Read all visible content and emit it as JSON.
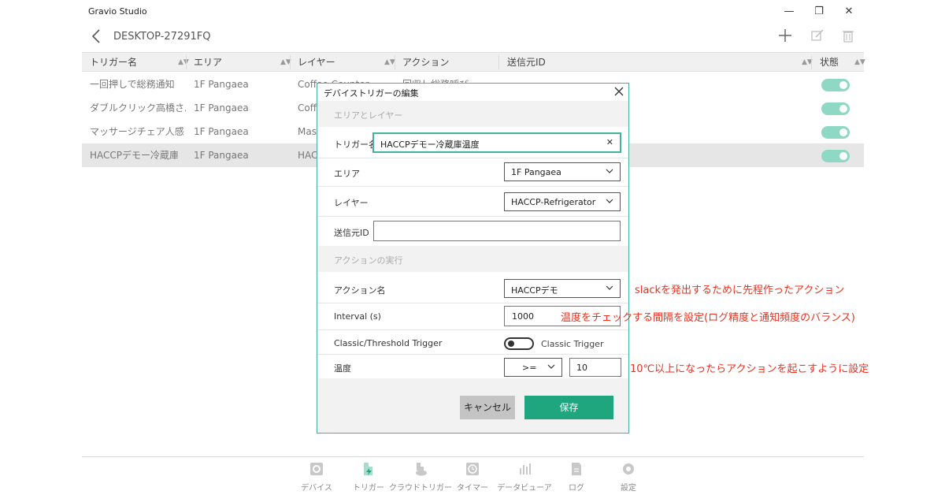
{
  "window": {
    "title": "Gravio Studio",
    "minimize": "—",
    "maximize": "❐",
    "close": "✕"
  },
  "header": {
    "device_name": "DESKTOP-27291FQ"
  },
  "table": {
    "headers": [
      "トリガー名",
      "エリア",
      "レイヤー",
      "アクション",
      "送信元ID",
      "状態"
    ],
    "sort_glyph": "▲▼",
    "rows": [
      {
        "name": "一回押しで総務通知",
        "area": "1F Pangaea",
        "layer": "Coffee Counter",
        "action": "回収し総務呼び",
        "enabled": true
      },
      {
        "name": "ダブルクリック高橋さん",
        "area": "1F Pangaea",
        "layer": "Coffee",
        "action": "",
        "enabled": true
      },
      {
        "name": "マッサージチェア人感",
        "area": "1F Pangaea",
        "layer": "Mas",
        "action": "",
        "enabled": true
      },
      {
        "name": "HACCPデモー冷蔵庫温",
        "area": "1F Pangaea",
        "layer": "HAC",
        "action": "",
        "enabled": true
      }
    ]
  },
  "nav": [
    {
      "label": "デバイス",
      "icon": "gear-icon"
    },
    {
      "label": "トリガー",
      "icon": "trigger-icon"
    },
    {
      "label": "クラウドトリガー",
      "icon": "cloud-trigger-icon"
    },
    {
      "label": "タイマー",
      "icon": "clock-icon"
    },
    {
      "label": "データビューア",
      "icon": "bar-chart-icon"
    },
    {
      "label": "ログ",
      "icon": "log-icon"
    },
    {
      "label": "設定",
      "icon": "settings-icon"
    }
  ],
  "dialog": {
    "title": "デバイストリガーの編集",
    "section_area": "エリアとレイヤー",
    "trigger_name_label": "トリガー名",
    "trigger_name_value": "HACCPデモー冷蔵庫温度",
    "clear_glyph": "✕",
    "area_label": "エリア",
    "area_value": "1F Pangaea",
    "layer_label": "レイヤー",
    "layer_value": "HACCP-Refrigerator",
    "sender_id_label": "送信元ID",
    "sender_id_value": "",
    "section_action": "アクションの実行",
    "action_name_label": "アクション名",
    "action_name_value": "HACCPデモ",
    "interval_label": "Interval (s)",
    "interval_value": "1000",
    "trigger_type_label": "Classic/Threshold Trigger",
    "trigger_type_value": "Classic Trigger",
    "temp_label": "温度",
    "temp_operator": ">=",
    "temp_value": "10",
    "cancel_label": "キャンセル",
    "save_label": "保存"
  },
  "annotations": {
    "action": "slackを発出するために先程作ったアクション",
    "interval": "温度をチェックする間隔を設定(ログ精度と通知頻度のバランス)",
    "threshold": "10℃以上になったらアクションを起こすように設定"
  },
  "colors": {
    "accent": "#20a67f",
    "dialog_border": "#3fb39b",
    "toggle_on": "#8fd8c4",
    "annotation": "#e8321f"
  }
}
